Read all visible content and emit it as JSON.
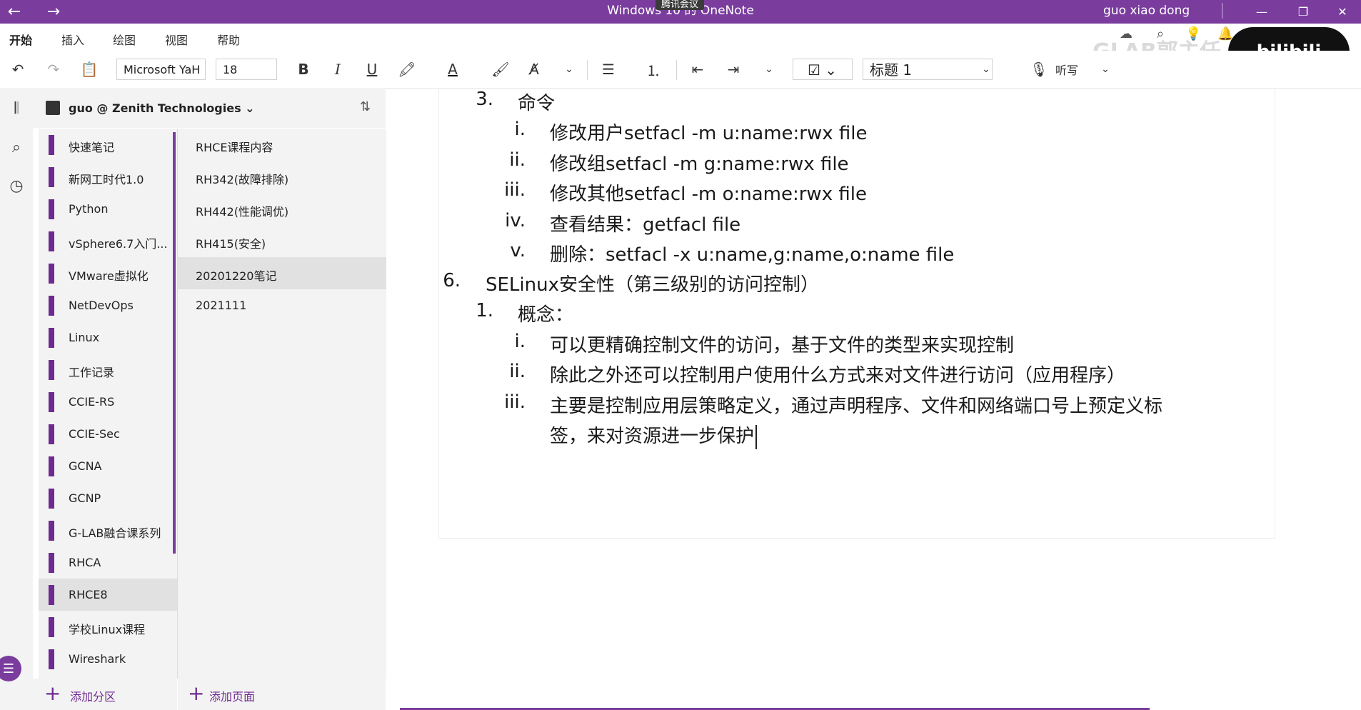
{
  "window": {
    "title": "Windows 10 的 OneNote",
    "meeting_label": "腾讯会议",
    "user": "guo xiao dong",
    "watermark": "GLAB郭主任"
  },
  "menu": [
    "开始",
    "插入",
    "绘图",
    "视图",
    "帮助"
  ],
  "toolbar": {
    "font_name": "Microsoft YaH",
    "font_size": "18",
    "style": "标题 1",
    "dictate": "听写"
  },
  "notebook": {
    "name": "guo @ Zenith Technologies"
  },
  "sections": [
    {
      "label": "快速笔记"
    },
    {
      "label": "新网工时代1.0"
    },
    {
      "label": "Python"
    },
    {
      "label": "vSphere6.7入门..."
    },
    {
      "label": "VMware虚拟化"
    },
    {
      "label": "NetDevOps"
    },
    {
      "label": "Linux"
    },
    {
      "label": "工作记录"
    },
    {
      "label": "CCIE-RS"
    },
    {
      "label": "CCIE-Sec"
    },
    {
      "label": "GCNA"
    },
    {
      "label": "GCNP"
    },
    {
      "label": "G-LAB融合课系列"
    },
    {
      "label": "RHCA"
    },
    {
      "label": "RHCE8"
    },
    {
      "label": "学校Linux课程"
    },
    {
      "label": "Wireshark"
    }
  ],
  "pages": [
    {
      "label": "RHCE课程内容"
    },
    {
      "label": "RH342(故障排除)"
    },
    {
      "label": "RH442(性能调优)"
    },
    {
      "label": "RH415(安全)"
    },
    {
      "label": "20201220笔记"
    },
    {
      "label": "2021111"
    }
  ],
  "add_section": "添加分区",
  "add_page": "添加页面",
  "note": {
    "lines": [
      {
        "num": "3.",
        "text": "命令"
      },
      {
        "num": "i.",
        "text": "修改用户setfacl -m u:name:rwx file"
      },
      {
        "num": "ii.",
        "text": "修改组setfacl -m g:name:rwx file"
      },
      {
        "num": "iii.",
        "text": "修改其他setfacl -m o:name:rwx file"
      },
      {
        "num": "iv.",
        "text": "查看结果：getfacl file"
      },
      {
        "num": "v.",
        "text": "删除：setfacl -x u:name,g:name,o:name file"
      },
      {
        "num": "6.",
        "text": "SELinux安全性（第三级别的访问控制）"
      },
      {
        "num": "1.",
        "text": "概念："
      },
      {
        "num": "i.",
        "text": "可以更精确控制文件的访问，基于文件的类型来实现控制"
      },
      {
        "num": "ii.",
        "text": "除此之外还可以控制用户使用什么方式来对文件进行访问（应用程序）"
      },
      {
        "num": "iii.",
        "text": "主要是控制应用层策略定义，通过声明程序、文件和网络端口号上预定义标"
      },
      {
        "num": "",
        "text": "签，来对资源进一步保护"
      }
    ]
  },
  "colors": {
    "accent": "#7a3d9e",
    "section_bar": "#6e2a8f",
    "selected_bg": "#e1e1e1",
    "pane_bg": "#f3f3f3"
  }
}
